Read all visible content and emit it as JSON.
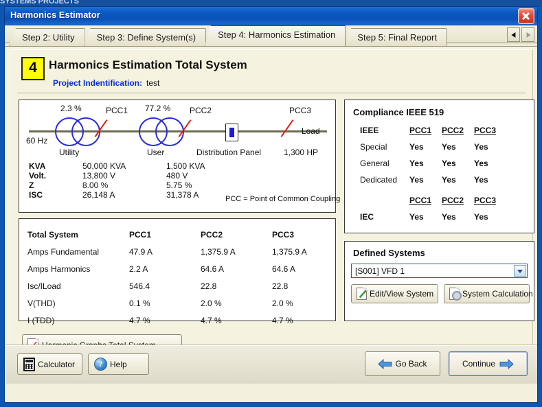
{
  "topstrip": {
    "ghost_text": "SYSTEMS          PROJECTS"
  },
  "window": {
    "title": "Harmonics Estimator",
    "close_label": "Close"
  },
  "tabs": {
    "items": [
      {
        "label": "Step 2: Utility",
        "active": false
      },
      {
        "label": "Step 3: Define System(s)",
        "active": false
      },
      {
        "label": "Step 4: Harmonics Estimation",
        "active": true
      },
      {
        "label": "Step 5: Final Report",
        "active": false
      }
    ],
    "scroll_left": "◀",
    "scroll_right": "▶"
  },
  "header": {
    "step_number": "4",
    "title": "Harmonics Estimation Total System",
    "project_label": "Project Indentification:",
    "project_value": "test"
  },
  "diagram": {
    "freq": "60 Hz",
    "load_label": "Load",
    "pcc_note": "PCC = Point of Common Coupling",
    "nodes": [
      {
        "name": "Utility",
        "percent": "2.3 %",
        "pcc": "PCC1"
      },
      {
        "name": "User",
        "percent": "77.2 %",
        "pcc": "PCC2"
      },
      {
        "name": "Distribution Panel",
        "percent": "",
        "pcc": "PCC3"
      }
    ],
    "load_rating": "1,300 HP",
    "specs": {
      "rows": [
        {
          "label": "KVA",
          "utility": "50,000 KVA",
          "user": "1,500 KVA"
        },
        {
          "label": "Volt.",
          "utility": "13,800 V",
          "user": "480 V"
        },
        {
          "label": "Z",
          "utility": "8.00 %",
          "user": "5.75 %"
        },
        {
          "label": "ISC",
          "utility": "26,148 A",
          "user": "31,378 A"
        }
      ]
    }
  },
  "totals": {
    "title": "Total System",
    "columns": [
      "PCC1",
      "PCC2",
      "PCC3"
    ],
    "rows": [
      {
        "label": "Amps Fundamental",
        "values": [
          "47.9 A",
          "1,375.9 A",
          "1,375.9 A"
        ]
      },
      {
        "label": "Amps Harmonics",
        "values": [
          "2.2 A",
          "64.6 A",
          "64.6 A"
        ]
      },
      {
        "label": "Isc/ILoad",
        "values": [
          "546.4",
          "22.8",
          "22.8"
        ]
      },
      {
        "label": "V(THD)",
        "values": [
          "0.1 %",
          "2.0 %",
          "2.0 %"
        ]
      },
      {
        "label": "I (TDD)",
        "values": [
          "4.7 %",
          "4.7 %",
          "4.7 %"
        ]
      }
    ]
  },
  "compliance": {
    "title": "Compliance IEEE 519",
    "ieee_label": "IEEE",
    "iec_label": "IEC",
    "columns": [
      "PCC1",
      "PCC2",
      "PCC3"
    ],
    "ieee_rows": [
      {
        "label": "Special",
        "values": [
          "Yes",
          "Yes",
          "Yes"
        ]
      },
      {
        "label": "General",
        "values": [
          "Yes",
          "Yes",
          "Yes"
        ]
      },
      {
        "label": "Dedicated",
        "values": [
          "Yes",
          "Yes",
          "Yes"
        ]
      }
    ],
    "iec_columns": [
      "PCC1",
      "PCC2",
      "PCC3"
    ],
    "iec_values": [
      "Yes",
      "Yes",
      "Yes"
    ]
  },
  "systems": {
    "title": "Defined Systems",
    "selected": "[S001] VFD 1",
    "edit_button": "Edit/View System",
    "calc_button": "System Calculation"
  },
  "actions": {
    "graphs_button": "Harmonic Graphs Total System",
    "calculator_button": "Calculator",
    "help_button": "Help",
    "go_back_button": "Go Back",
    "continue_button": "Continue"
  },
  "colors": {
    "titlebar": "#0a56c0",
    "accent_blue": "#1b3fb8",
    "badge_yellow": "#ffff00",
    "pcc_red": "#e02010",
    "transformer_blue": "#2b2bdd",
    "panel_bg": "#f5f2e0"
  }
}
